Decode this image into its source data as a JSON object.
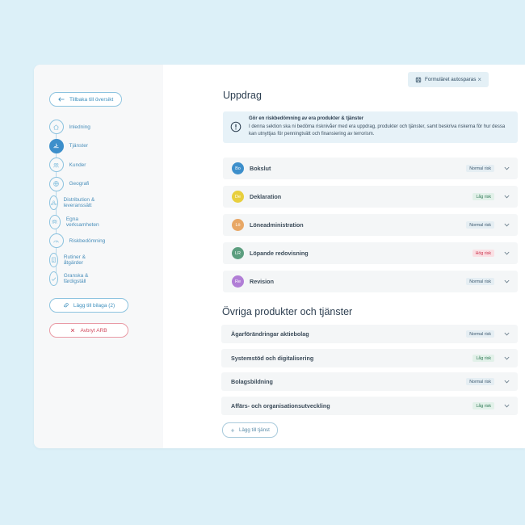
{
  "sidebar": {
    "back_label": "Tillbaka till översikt",
    "steps": [
      {
        "label": "Inledning",
        "icon": "home-icon",
        "active": false
      },
      {
        "label": "Tjänster",
        "icon": "hand-icon",
        "active": true
      },
      {
        "label": "Kunder",
        "icon": "users-icon",
        "active": false
      },
      {
        "label": "Geografi",
        "icon": "globe-icon",
        "active": false
      },
      {
        "label": "Distribution & leveranssätt",
        "icon": "network-icon",
        "active": false
      },
      {
        "label": "Egna verksamheten",
        "icon": "team-icon",
        "active": false
      },
      {
        "label": "Riskbedömning",
        "icon": "gauge-icon",
        "active": false
      },
      {
        "label": "Rutiner & åtgärder",
        "icon": "clipboard-icon",
        "active": false
      },
      {
        "label": "Granska & färdigställ",
        "icon": "check-icon",
        "active": false
      }
    ],
    "attach_label": "Lägg till bilaga (2)",
    "cancel_label": "Avbryt ARB"
  },
  "autosave": {
    "label": "Formuläret autosparas",
    "close": "×"
  },
  "main": {
    "title": "Uppdrag",
    "notice": {
      "title": "Gör en riskbedömning av era produkter & tjänster",
      "body": "I denna sektion ska ni bedöma risknivåer med era uppdrag, produkter och tjänster, samt beskriva riskerna för hur dessa kan utnyttjas för penningtvätt och finansiering av terrorism."
    },
    "assignments": [
      {
        "initials": "Bo",
        "name": "Bokslut",
        "risk": "Normal risk",
        "level": "normal",
        "color": "#3d8fcb"
      },
      {
        "initials": "De",
        "name": "Deklaration",
        "risk": "Låg risk",
        "level": "low",
        "color": "#e8cf3e"
      },
      {
        "initials": "Lö",
        "name": "Löneadministration",
        "risk": "Normal risk",
        "level": "normal",
        "color": "#e8a765"
      },
      {
        "initials": "LR",
        "name": "Löpande redovisning",
        "risk": "Hög risk",
        "level": "high",
        "color": "#5c9e7f"
      },
      {
        "initials": "Re",
        "name": "Revision",
        "risk": "Normal risk",
        "level": "normal",
        "color": "#b17ed6"
      }
    ],
    "other_title": "Övriga produkter och tjänster",
    "others": [
      {
        "name": "Ägarförändringar aktiebolag",
        "risk": "Normal risk",
        "level": "normal"
      },
      {
        "name": "Systemstöd och digitalisering",
        "risk": "Låg risk",
        "level": "low"
      },
      {
        "name": "Bolagsbildning",
        "risk": "Normal risk",
        "level": "normal"
      },
      {
        "name": "Affärs- och organisationsutveckling",
        "risk": "Låg risk",
        "level": "low"
      }
    ],
    "add_service_label": "Lägg till tjänst"
  }
}
